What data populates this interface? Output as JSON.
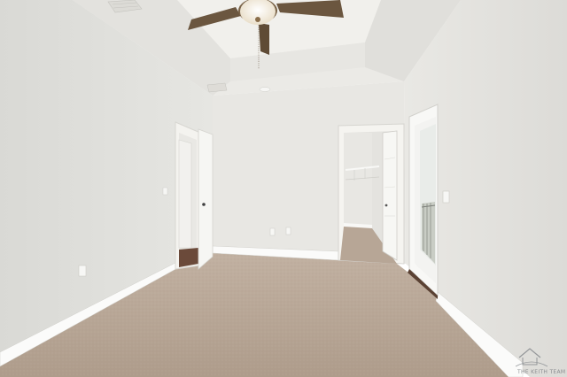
{
  "scene": {
    "subject": "empty-bedroom-interior",
    "colors": {
      "wall_left": "#e2e2de",
      "wall_back": "#e9e8e4",
      "wall_right": "#e6e5e1",
      "ceiling": "#ecebe7",
      "carpet": "#b9a898",
      "baseboard": "#fbfbfa",
      "fan_blade": "#6b563f",
      "fan_light": "#f4ecdc"
    }
  },
  "watermark": {
    "icon": "brand-logo-icon",
    "lettering": "THE KEITH TEAM"
  }
}
